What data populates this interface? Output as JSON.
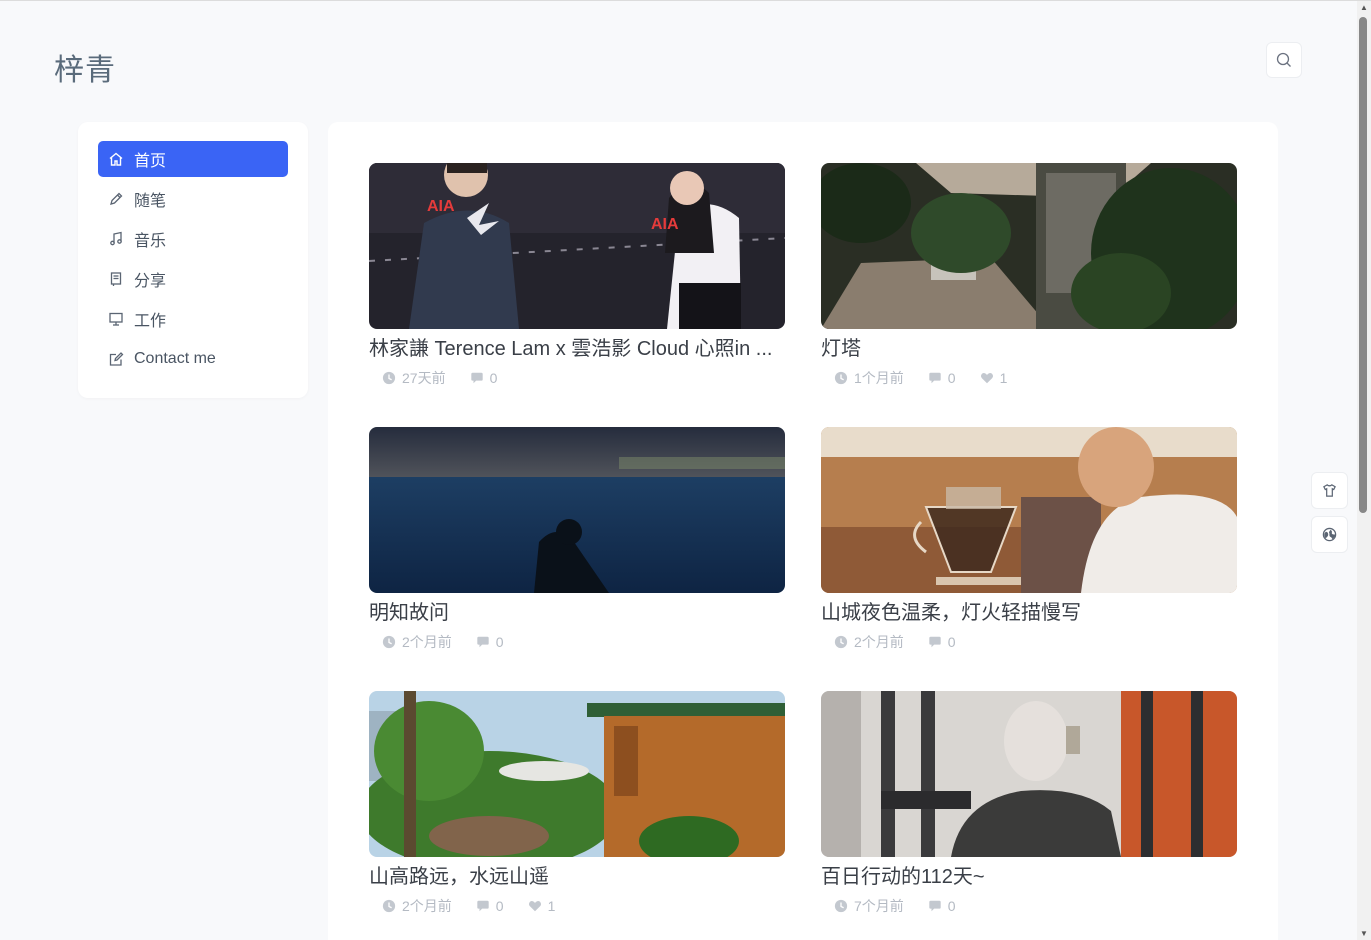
{
  "site": {
    "title": "梓青"
  },
  "nav": [
    {
      "label": "首页",
      "icon": "home-icon",
      "active": true
    },
    {
      "label": "随笔",
      "icon": "pencil-icon",
      "active": false
    },
    {
      "label": "音乐",
      "icon": "music-icon",
      "active": false
    },
    {
      "label": "分享",
      "icon": "book-icon",
      "active": false
    },
    {
      "label": "工作",
      "icon": "monitor-icon",
      "active": false
    },
    {
      "label": "Contact  me",
      "icon": "edit-icon",
      "active": false
    }
  ],
  "posts": [
    {
      "title": "林家謙 Terence Lam x 雲浩影 Cloud 心照in ...",
      "time": "27天前",
      "comments": "0",
      "likes": null
    },
    {
      "title": "灯塔",
      "time": "1个月前",
      "comments": "0",
      "likes": "1"
    },
    {
      "title": "明知故问",
      "time": "2个月前",
      "comments": "0",
      "likes": null
    },
    {
      "title": "山城夜色温柔，灯火轻描慢写",
      "time": "2个月前",
      "comments": "0",
      "likes": null
    },
    {
      "title": "山高路远，水远山遥",
      "time": "2个月前",
      "comments": "0",
      "likes": "1"
    },
    {
      "title": "百日行动的112天~",
      "time": "7个月前",
      "comments": "0",
      "likes": null
    }
  ],
  "colors": {
    "accent": "#3a64f5",
    "background": "#f8f9fb"
  }
}
